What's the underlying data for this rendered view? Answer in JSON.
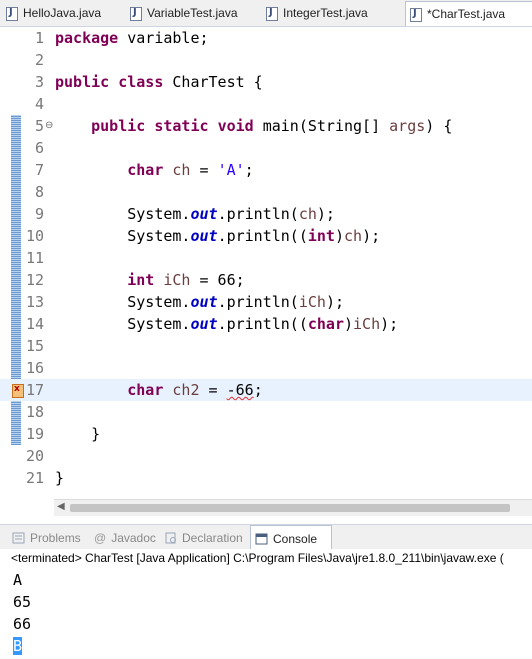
{
  "tabs": [
    {
      "label": "HelloJava.java",
      "active": false
    },
    {
      "label": "VariableTest.java",
      "active": false
    },
    {
      "label": "IntegerTest.java",
      "active": false
    },
    {
      "label": "*CharTest.java",
      "active": true
    }
  ],
  "code_lines": [
    {
      "n": "1",
      "text": "package variable;"
    },
    {
      "n": "2",
      "text": ""
    },
    {
      "n": "3",
      "text": "public class CharTest {"
    },
    {
      "n": "4",
      "text": ""
    },
    {
      "n": "5",
      "text": "    public static void main(String[] args) {"
    },
    {
      "n": "6",
      "text": ""
    },
    {
      "n": "7",
      "text": "        char ch = 'A';"
    },
    {
      "n": "8",
      "text": ""
    },
    {
      "n": "9",
      "text": "        System.out.println(ch);"
    },
    {
      "n": "10",
      "text": "        System.out.println((int)ch);"
    },
    {
      "n": "11",
      "text": ""
    },
    {
      "n": "12",
      "text": "        int iCh = 66;"
    },
    {
      "n": "13",
      "text": "        System.out.println(iCh);"
    },
    {
      "n": "14",
      "text": "        System.out.println((char)iCh);"
    },
    {
      "n": "15",
      "text": ""
    },
    {
      "n": "16",
      "text": ""
    },
    {
      "n": "17",
      "text": "        char ch2 = -66;"
    },
    {
      "n": "18",
      "text": ""
    },
    {
      "n": "19",
      "text": "    }"
    },
    {
      "n": "20",
      "text": ""
    },
    {
      "n": "21",
      "text": "}"
    }
  ],
  "panel_tabs": [
    {
      "label": "Problems",
      "active": false,
      "icon": "problems-icon"
    },
    {
      "label": "Javadoc",
      "active": false,
      "icon": "javadoc-icon"
    },
    {
      "label": "Declaration",
      "active": false,
      "icon": "declaration-icon"
    },
    {
      "label": "Console",
      "active": true,
      "icon": "console-icon"
    }
  ],
  "console": {
    "status": "<terminated> CharTest [Java Application] C:\\Program Files\\Java\\jre1.8.0_211\\bin\\javaw.exe (",
    "output": [
      "A",
      "65",
      "66",
      "B"
    ]
  },
  "colors": {
    "keyword": "#7f0055",
    "string": "#2a00ff",
    "field": "#0000c0",
    "variable": "#6a3e3e",
    "current_line": "#e8f2fe",
    "selection": "#3399ff"
  }
}
